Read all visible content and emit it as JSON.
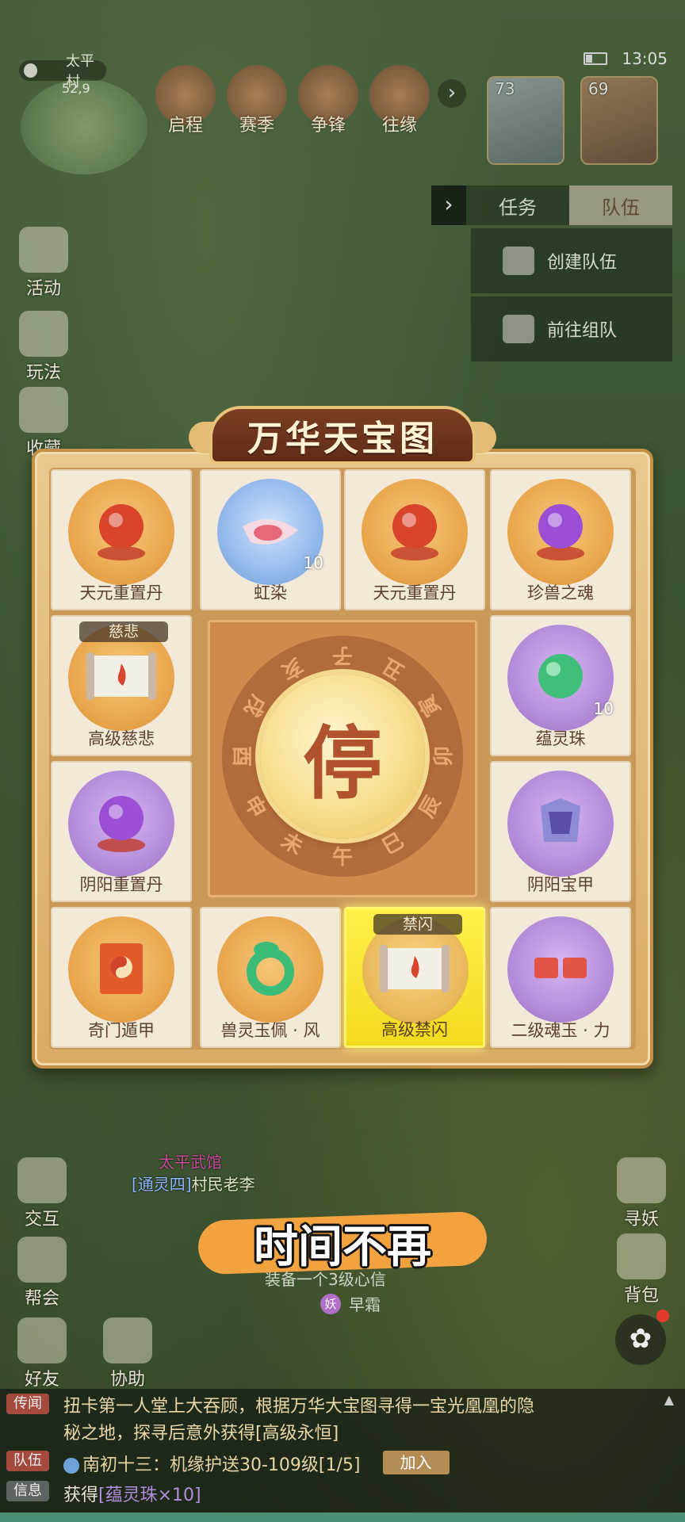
{
  "status": {
    "time": "13:05"
  },
  "minimap": {
    "location": "太平村",
    "coords": "52,9"
  },
  "top_menu": [
    {
      "label": "启程",
      "icon": "scroll-flag-icon"
    },
    {
      "label": "赛季",
      "icon": "book-icon"
    },
    {
      "label": "争锋",
      "icon": "banner-icon"
    },
    {
      "label": "往缘",
      "icon": "blossom-icon"
    }
  ],
  "portraits": [
    {
      "level": "73"
    },
    {
      "level": "69"
    }
  ],
  "team_panel": {
    "tabs": [
      {
        "label": "任务"
      },
      {
        "label": "队伍"
      }
    ],
    "active_tab": "队伍",
    "buttons": [
      {
        "label": "创建队伍"
      },
      {
        "label": "前往组队"
      }
    ]
  },
  "side_menu_left": [
    {
      "label": "活动"
    },
    {
      "label": "玩法"
    },
    {
      "label": "收藏"
    }
  ],
  "wheel": {
    "title": "万华天宝图",
    "center_button": "停",
    "ring_chars": [
      "子",
      "丑",
      "寅",
      "卯",
      "辰",
      "巳",
      "午",
      "未",
      "申",
      "酉",
      "戌",
      "亥"
    ],
    "items": [
      {
        "name": "天元重置丹",
        "tag": "",
        "count": "",
        "style": "gold",
        "icon": "red-orb-icon"
      },
      {
        "name": "虹染",
        "tag": "",
        "count": "10",
        "style": "blue",
        "icon": "dye-icon"
      },
      {
        "name": "天元重置丹",
        "tag": "",
        "count": "",
        "style": "gold",
        "icon": "red-orb-icon"
      },
      {
        "name": "珍兽之魂",
        "tag": "",
        "count": "",
        "style": "gold",
        "icon": "purple-orb-icon"
      },
      {
        "name": "高级慈悲",
        "tag": "慈悲",
        "count": "",
        "style": "gold",
        "icon": "scroll-icon"
      },
      {
        "name": "蕴灵珠",
        "tag": "",
        "count": "10",
        "style": "purple",
        "icon": "green-pearl-icon"
      },
      {
        "name": "阴阳重置丹",
        "tag": "",
        "count": "",
        "style": "purple",
        "icon": "purple-orb-icon"
      },
      {
        "name": "阴阳宝甲",
        "tag": "",
        "count": "",
        "style": "purple",
        "icon": "armor-icon"
      },
      {
        "name": "奇门遁甲",
        "tag": "",
        "count": "",
        "style": "gold",
        "icon": "yinyang-book-icon"
      },
      {
        "name": "兽灵玉佩 · 风",
        "tag": "",
        "count": "",
        "style": "gold",
        "icon": "jade-dragon-icon"
      },
      {
        "name": "高级禁闪",
        "tag": "禁闪",
        "count": "",
        "style": "highlight",
        "icon": "scroll-icon"
      },
      {
        "name": "二级魂玉 · 力",
        "tag": "",
        "count": "",
        "style": "purple",
        "icon": "soul-jade-icon"
      }
    ]
  },
  "scene": {
    "npc_title": "太平武馆",
    "npc_prefix": "[通灵四]",
    "npc_name": "村民老李",
    "caption": "时间不再",
    "hint": "装备一个3级心信",
    "player_badge": "妖",
    "player_name": "早霜"
  },
  "side_menu_left_bottom": [
    {
      "label": "交互"
    },
    {
      "label": "帮会"
    },
    {
      "label": "好友"
    },
    {
      "label": "协助"
    }
  ],
  "side_menu_right": [
    {
      "label": "寻妖"
    },
    {
      "label": "背包"
    }
  ],
  "chat": [
    {
      "channel": "传闻",
      "text_a": "扭卡第一人",
      "text_b": "堂上大吞顾，根据万华大宝图寻得一宝光凰凰的隐",
      "text_c": "秘之地，探寻后意外获得[高级永恒]"
    },
    {
      "channel": "队伍",
      "text": "南初十三：机缘护送30-109级[1/5]",
      "button": "加入"
    },
    {
      "channel": "信息",
      "text": "获得",
      "highlight": "[蕴灵珠×10]"
    }
  ]
}
